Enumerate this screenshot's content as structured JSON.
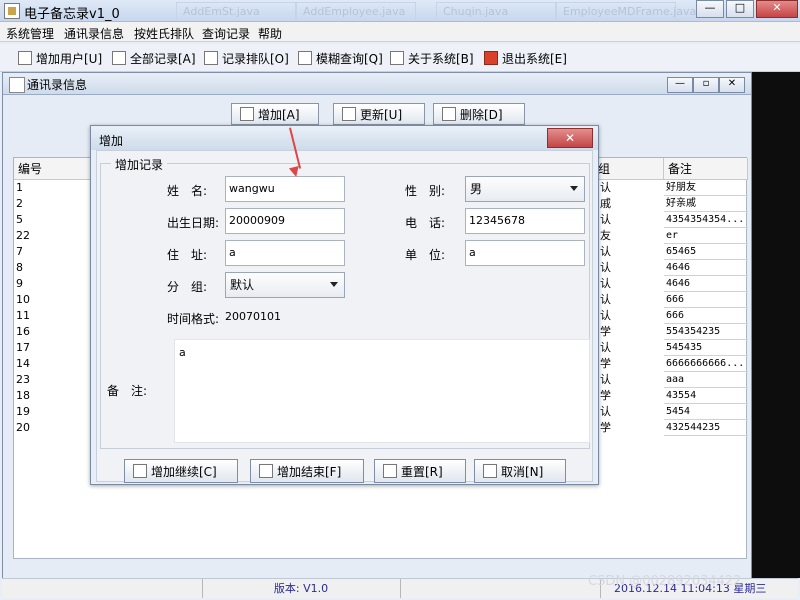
{
  "window": {
    "title": "电子备忘录v1_0"
  },
  "ghost_tabs": [
    "AddEmSt.java",
    "AddEmployee.java",
    "Chuqin.java",
    "EmployeeMDFrame.java"
  ],
  "menubar": {
    "items": [
      "系统管理",
      "通讯录信息",
      "按姓氏排队",
      "查询记录",
      "帮助"
    ]
  },
  "toolbar": {
    "items": [
      {
        "label": "增加用户[U]",
        "icon": "add-user-icon"
      },
      {
        "label": "全部记录[A]",
        "icon": "all-records-icon"
      },
      {
        "label": "记录排队[O]",
        "icon": "sort-records-icon"
      },
      {
        "label": "模糊查询[Q]",
        "icon": "search-icon"
      },
      {
        "label": "关于系统[B]",
        "icon": "about-icon"
      },
      {
        "label": "退出系统[E]",
        "icon": "exit-icon"
      }
    ]
  },
  "inner_window": {
    "title": "通讯录信息"
  },
  "panel_buttons": {
    "add": "增加[A]",
    "update": "更新[U]",
    "delete": "删除[D]"
  },
  "table": {
    "headers": {
      "id": "编号",
      "group": "组",
      "note": "备注"
    },
    "rows": [
      {
        "id": "1",
        "group": "认",
        "note": "好朋友"
      },
      {
        "id": "2",
        "group": "戚",
        "note": "好亲戚"
      },
      {
        "id": "5",
        "group": "认",
        "note": "4354354354..."
      },
      {
        "id": "22",
        "group": "友",
        "note": "er"
      },
      {
        "id": "7",
        "group": "认",
        "note": "65465"
      },
      {
        "id": "8",
        "group": "认",
        "note": "4646"
      },
      {
        "id": "9",
        "group": "认",
        "note": "4646"
      },
      {
        "id": "10",
        "group": "认",
        "note": "666"
      },
      {
        "id": "11",
        "group": "认",
        "note": "666"
      },
      {
        "id": "16",
        "group": "学",
        "note": "554354235"
      },
      {
        "id": "17",
        "group": "认",
        "note": "545435"
      },
      {
        "id": "14",
        "group": "学",
        "note": "6666666666..."
      },
      {
        "id": "23",
        "group": "认",
        "note": "aaa"
      },
      {
        "id": "18",
        "group": "学",
        "note": "43554"
      },
      {
        "id": "19",
        "group": "认",
        "note": "5454"
      },
      {
        "id": "20",
        "group": "学",
        "note": "432544235"
      }
    ]
  },
  "dialog": {
    "title": "增加",
    "group_title": "增加记录",
    "labels": {
      "name": "姓　名:",
      "gender": "性　别:",
      "birthdate": "出生日期:",
      "phone": "电　话:",
      "address": "住　址:",
      "unit": "单　位:",
      "group": "分　组:",
      "time_format_label": "时间格式:",
      "remark": "备　注:"
    },
    "values": {
      "name": "wangwu",
      "gender": "男",
      "birthdate": "20000909",
      "phone": "12345678",
      "address": "a",
      "unit": "a",
      "group": "默认",
      "time_format": "20070101",
      "remark": "a"
    },
    "buttons": {
      "continue": "增加继续[C]",
      "finish": "增加结束[F]",
      "reset": "重置[R]",
      "cancel": "取消[N]"
    }
  },
  "statusbar": {
    "version": "版本: V1.0",
    "datetime": "2016.12.14 11:04:13  星期三"
  },
  "watermark": "CSDN @002892034422",
  "colors": {
    "accent_red": "#e04545",
    "status_text": "#2b2b9a"
  }
}
